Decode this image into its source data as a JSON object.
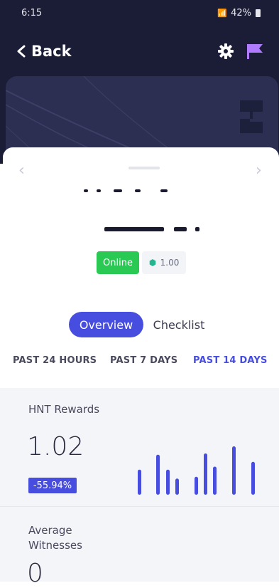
{
  "status_bar": {
    "time": "6:15",
    "battery": "42%"
  },
  "header": {
    "back_label": "Back"
  },
  "badges": {
    "online": "Online",
    "transmit_scale": "1.00"
  },
  "tabs": [
    {
      "label": "Overview",
      "active": true
    },
    {
      "label": "Checklist",
      "active": false
    }
  ],
  "periods": [
    {
      "label": "PAST 24 HOURS",
      "active": false
    },
    {
      "label": "PAST 7 DAYS",
      "active": false
    },
    {
      "label": "PAST 14 DAYS",
      "active": true
    }
  ],
  "stats": {
    "hnt_rewards": {
      "label": "HNT Rewards",
      "value": "1.02",
      "change": "-55.94%"
    },
    "average_witnesses": {
      "label": "Average Witnesses",
      "value": "0"
    }
  },
  "chart_data": {
    "type": "bar",
    "series": [
      {
        "values": [
          0.42,
          0.67,
          0.42,
          0.27,
          0.3,
          0.69,
          0.47,
          0.81,
          0.55
        ]
      }
    ],
    "ylim": [
      0,
      1
    ],
    "grid": false,
    "legend": "none"
  },
  "colors": {
    "accent": "#474dde",
    "header_bg": "#1b1d36",
    "online_green": "#29c954",
    "flag_purple": "#b17bff",
    "hex_green": "#23b58f"
  },
  "icons": {
    "back": "chevron-left-icon",
    "settings": "gear-icon",
    "report": "flag-icon",
    "prev": "chevron-left-icon",
    "next": "chevron-right-icon",
    "transmit": "hexagon-icon"
  }
}
